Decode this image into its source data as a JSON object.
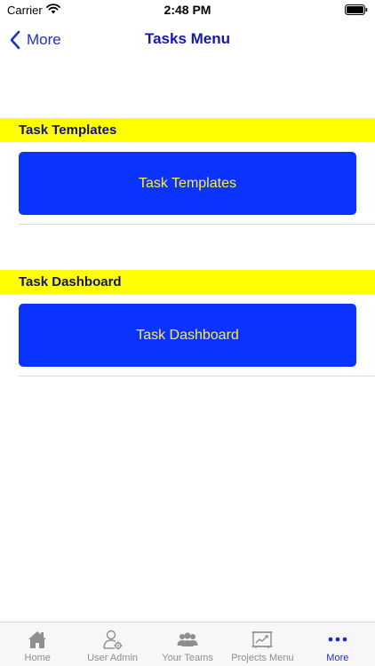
{
  "status_bar": {
    "carrier": "Carrier",
    "time": "2:48 PM"
  },
  "nav": {
    "back_label": "More",
    "title": "Tasks Menu"
  },
  "sections": [
    {
      "header": "Task Templates",
      "button_label": "Task Templates"
    },
    {
      "header": "Task Dashboard",
      "button_label": "Task Dashboard"
    }
  ],
  "tab_bar": {
    "items": [
      {
        "label": "Home",
        "icon": "home-icon",
        "active": false
      },
      {
        "label": "User Admin",
        "icon": "user-admin-icon",
        "active": false
      },
      {
        "label": "Your Teams",
        "icon": "teams-icon",
        "active": false
      },
      {
        "label": "Projects Menu",
        "icon": "projects-icon",
        "active": false
      },
      {
        "label": "More",
        "icon": "more-icon",
        "active": true
      }
    ]
  },
  "colors": {
    "accent": "#1f2fcf",
    "section_header_bg": "#ffff00",
    "button_bg": "#0a33ff",
    "button_text": "#ffee33"
  }
}
